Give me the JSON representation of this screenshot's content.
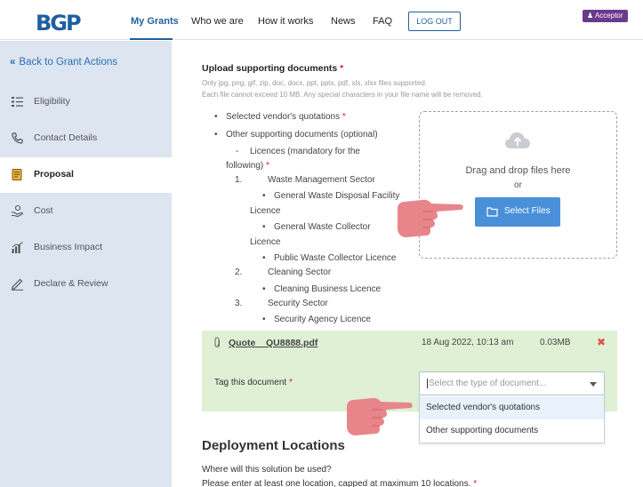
{
  "header": {
    "logo": "BGP",
    "nav": [
      "My Grants",
      "Who we are",
      "How it works",
      "News",
      "FAQ"
    ],
    "logout": "LOG OUT",
    "role_badge": "Acceptor"
  },
  "sidebar": {
    "back": "Back to Grant Actions",
    "items": [
      {
        "label": "Eligibility",
        "icon": "list-icon"
      },
      {
        "label": "Contact Details",
        "icon": "phone-icon"
      },
      {
        "label": "Proposal",
        "icon": "proposal-doc-icon"
      },
      {
        "label": "Cost",
        "icon": "money-hand-icon"
      },
      {
        "label": "Business Impact",
        "icon": "bar-chart-icon"
      },
      {
        "label": "Declare & Review",
        "icon": "pen-icon"
      }
    ],
    "active_index": 2
  },
  "upload": {
    "title": "Upload supporting documents",
    "hint1": "Only jpg, png, gif, zip, doc, docx, ppt, pptx, pdf, xls, xlsx files supported.",
    "hint2": "Each file cannot exceed 10 MB. Any special characters in your file name will be removed.",
    "docs": {
      "vendor_quotes": "Selected vendor's quotations",
      "other_docs": "Other supporting documents (optional)",
      "licences_dash": "-",
      "licences_a": "Licences (mandatory for the",
      "licences_b": "following)",
      "n1": "1.",
      "waste_sector": "Waste Management Sector",
      "gwdf_a": "General Waste Disposal Facility",
      "gwdf_b": "Licence",
      "gwc_a": "General Waste Collector",
      "gwc_b": "Licence",
      "pwc": "Public Waste Collector Licence",
      "n2": "2.",
      "cleaning_sector": "Cleaning Sector",
      "cleaning_licence": "Cleaning Business Licence",
      "n3": "3.",
      "security_sector": "Security Sector",
      "security_licence": "Security Agency Licence"
    },
    "dropzone": {
      "drag_text": "Drag and drop files here",
      "or": "or",
      "button": "Select Files"
    }
  },
  "file": {
    "name": "Quote__QU8888.pdf",
    "date": "18 Aug 2022, 10:13 am",
    "size": "0.03MB",
    "remove": "✖",
    "tag_label": "Tag this document",
    "select_placeholder": "Select the type of document...",
    "options": [
      "Selected vendor's quotations",
      "Other supporting documents"
    ]
  },
  "deployment": {
    "title": "Deployment Locations",
    "question": "Where will this solution be used?",
    "instruction": "Please enter at least one location, capped at maximum 10 locations."
  },
  "colors": {
    "brand": "#1f5f9e",
    "sidebar_bg": "#dde5f0",
    "file_row_bg": "#dff0d4",
    "button_blue": "#4a90d9",
    "required_red": "#d02030",
    "badge_purple": "#6a3a8e",
    "pointer_pink": "#e8858a"
  }
}
